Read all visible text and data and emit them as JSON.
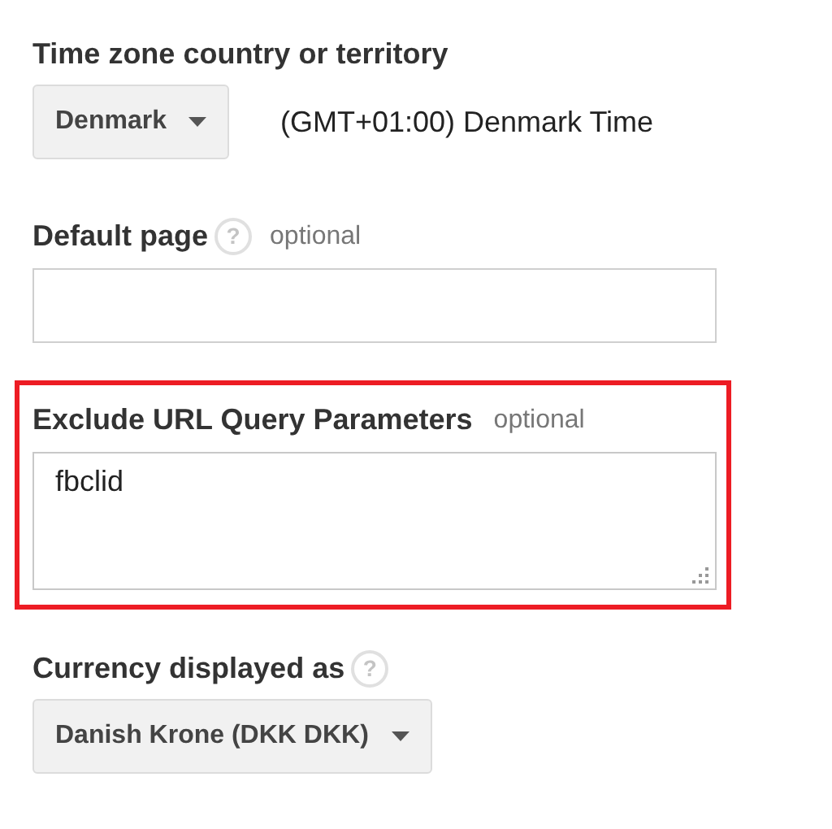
{
  "fields": [
    {
      "kind": "select",
      "label": "Time zone country or territory",
      "value": "Denmark",
      "note": "(GMT+01:00) Denmark Time",
      "highlighted": false
    },
    {
      "kind": "text",
      "label": "Default page",
      "help": "?",
      "optional": "optional",
      "highlighted": false
    },
    {
      "kind": "textarea",
      "label": "Exclude URL Query Parameters",
      "optional": "optional",
      "value": "fbclid",
      "highlighted": true
    },
    {
      "kind": "select",
      "label": "Currency displayed as",
      "help": "?",
      "value": "Danish Krone (DKK DKK)",
      "highlighted": false
    }
  ]
}
